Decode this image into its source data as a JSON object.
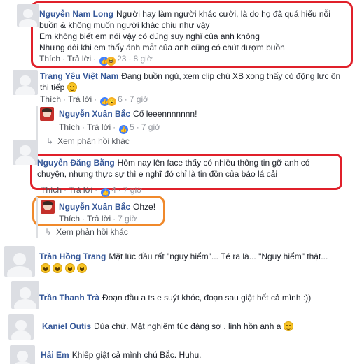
{
  "comments": [
    {
      "name": "Nguyễn Nam Long",
      "text": "Người hay làm người khác cười, là do họ đã quá hiểu nỗi buồn & không muốn người khác chịu như vậy\nEm không biết em nói vậy có đúng suy nghĩ của anh không\nNhưng đôi khi em thấy ánh mắt của anh cũng có chút đượm buồn",
      "actions": {
        "like": "Thích",
        "reply": "Trả lời",
        "count": "23",
        "time": "8 giờ"
      }
    },
    {
      "name": "Trang Yêu Việt Nam",
      "text": "Đang buồn ngủ, xem clip chú XB xong thấy có động lực ôn thi tiếp",
      "actions": {
        "like": "Thích",
        "reply": "Trả lời",
        "count": "6",
        "time": "7 giờ"
      }
    },
    {
      "name": "Nguyễn Xuân Bắc",
      "text": "Cố leeennnnnnn!",
      "actions": {
        "like": "Thích",
        "reply": "Trả lời",
        "count": "5",
        "time": "7 giờ"
      }
    },
    {
      "name": "Nguyễn Đăng Bằng",
      "text": "Hôm nay lên face thấy có nhiều thông tin gỡ anh có chuyện, nhưng thực sự thì e nghĩ đó chỉ là tin đồn của báo lá cải",
      "actions": {
        "like": "Thích",
        "reply": "Trả lời",
        "count": "4",
        "time": "7 giờ"
      }
    },
    {
      "name": "Nguyễn Xuân Bắc",
      "text": "Ohze!",
      "actions": {
        "like": "Thích",
        "reply": "Trả lời",
        "time": "7 giờ"
      }
    },
    {
      "name": "Trần Hồng Trang",
      "text": "Mặt lúc đầu rất \"nguy hiểm\"... Té ra là... \"Nguy hiểm\" thật...",
      "actions": {}
    },
    {
      "name": "Trần Thanh Trà",
      "text": "Đoạn đầu a ts e suýt khóc, đoạn sau giật hết cả mình :))",
      "actions": {}
    },
    {
      "name": "Kaniel Outis",
      "text": "Đùa chứ. Mặt nghiêm túc đáng sợ . linh hồn anh a",
      "actions": {}
    },
    {
      "name": "Hải Em",
      "text": "Khiếp giật cả mình chú Bắc. Huhu.",
      "actions": {}
    }
  ],
  "more_replies": "Xem phản hồi khác",
  "icons": {
    "like_reaction": "thumbs-up-icon",
    "haha_reaction": "laughing-face-icon",
    "wow_reaction": "surprised-face-icon",
    "smile_emoji": "smiling-face-icon",
    "more_replies": "reply-arrow-icon"
  },
  "colors": {
    "name": "#365899",
    "highlight_red": "#e0202a",
    "highlight_orange": "#f0892b"
  }
}
